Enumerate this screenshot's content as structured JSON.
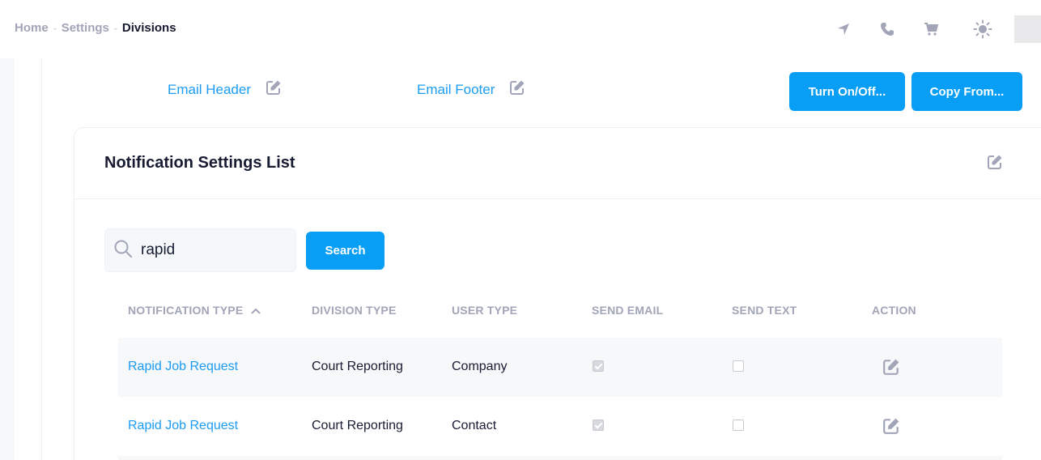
{
  "breadcrumb": {
    "home": "Home",
    "settings": "Settings",
    "current": "Divisions"
  },
  "topbar_icons": [
    "navigation-icon",
    "phone-icon",
    "cart-icon",
    "sun-icon"
  ],
  "email_links": {
    "header": "Email Header",
    "footer": "Email Footer"
  },
  "actions": {
    "turn_on_off": "Turn On/Off...",
    "copy_from": "Copy From..."
  },
  "card": {
    "title": "Notification Settings List"
  },
  "search": {
    "value": "rapid",
    "button": "Search"
  },
  "table": {
    "columns": [
      "NOTIFICATION TYPE",
      "DIVISION TYPE",
      "USER TYPE",
      "SEND EMAIL",
      "SEND TEXT",
      "ACTION"
    ],
    "rows": [
      {
        "notification_type": "Rapid Job Request",
        "division_type": "Court Reporting",
        "user_type": "Company",
        "send_email": true,
        "send_text": false
      },
      {
        "notification_type": "Rapid Job Request",
        "division_type": "Court Reporting",
        "user_type": "Contact",
        "send_email": true,
        "send_text": false
      }
    ]
  },
  "colors": {
    "primary": "#089ef5",
    "link": "#1b9cf2",
    "muted": "#a1a5b7"
  }
}
